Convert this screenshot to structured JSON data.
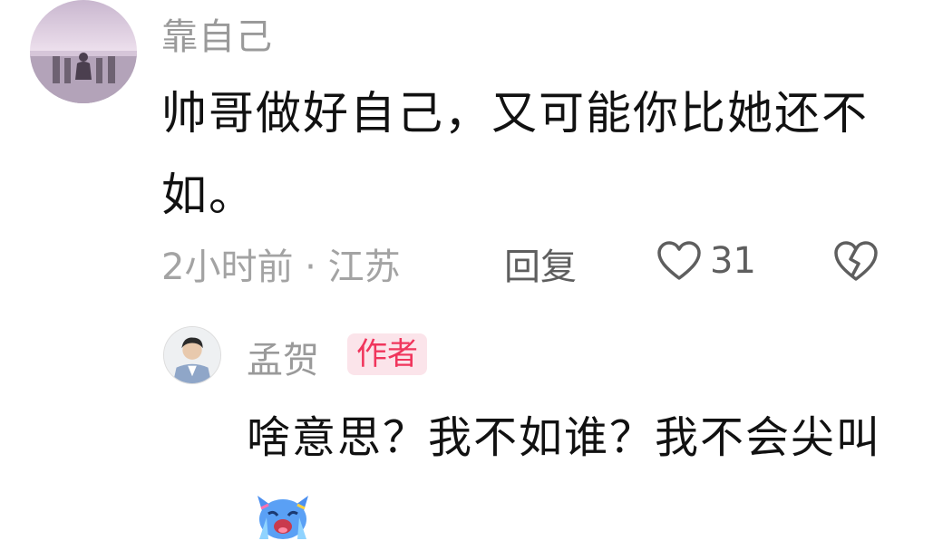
{
  "comment": {
    "username": "靠自己",
    "text": "帅哥做好自己，又可能你比她还不如。",
    "time_location": "2小时前 · 江苏",
    "reply_label": "回复",
    "like_count": "31",
    "icons": {
      "avatar": "avatar-image",
      "like": "heart-outline-icon",
      "dislike": "broken-heart-icon"
    }
  },
  "reply": {
    "username": "孟贺",
    "badge": "作者",
    "text": "啥意思？我不如谁？我不会尖叫",
    "icons": {
      "avatar": "avatar-image",
      "emoji": "crying-cat-emoji"
    }
  },
  "colors": {
    "text_primary": "#111111",
    "text_secondary": "#9a9a9a",
    "badge_bg": "#fbe4ea",
    "badge_text": "#f0355c"
  }
}
